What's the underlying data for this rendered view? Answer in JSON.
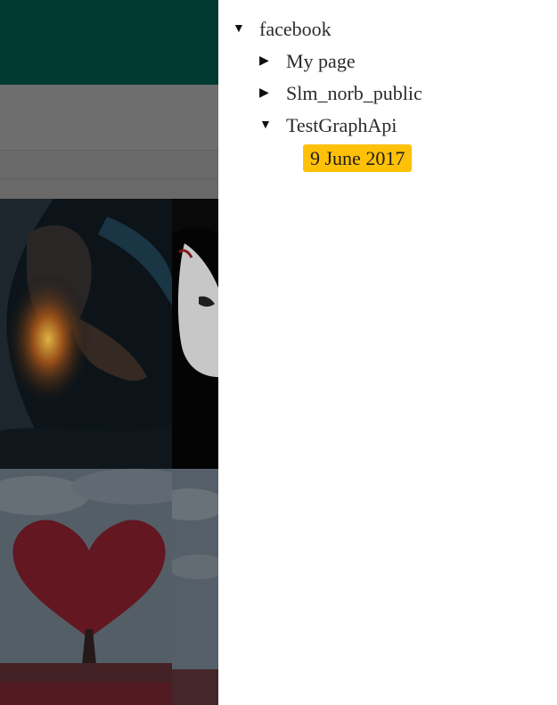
{
  "background_app": {
    "header_color": "#003f36",
    "tiles": [
      {
        "name": "dark-figure-photo"
      },
      {
        "name": "portrait-photo"
      },
      {
        "name": "heart-tree-photo"
      },
      {
        "name": "sky-photo"
      }
    ]
  },
  "tree": {
    "root": {
      "label": "facebook",
      "expanded": true,
      "toggle_icon": "triangle-down-icon"
    },
    "children": [
      {
        "label": "My page",
        "expanded": false,
        "toggle_icon": "triangle-right-icon"
      },
      {
        "label": "Slm_norb_public",
        "expanded": false,
        "toggle_icon": "triangle-right-icon"
      },
      {
        "label": "TestGraphApi",
        "expanded": true,
        "toggle_icon": "triangle-down-icon",
        "children": [
          {
            "label": "9 June 2017",
            "selected": true
          }
        ]
      }
    ],
    "selected_color": "#ffc107"
  }
}
